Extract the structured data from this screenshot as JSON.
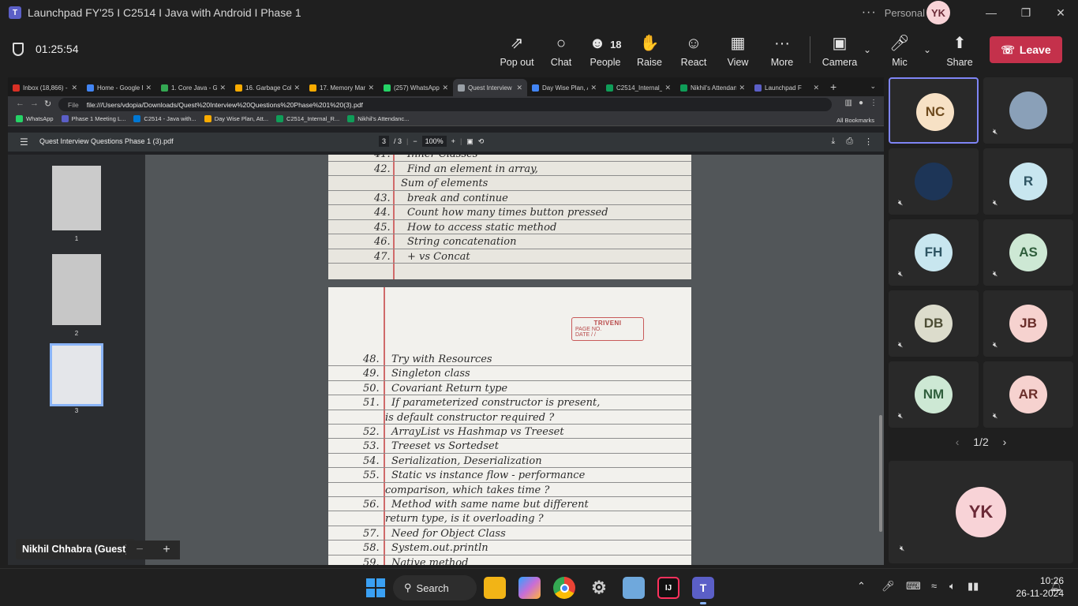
{
  "window": {
    "title": "Launchpad FY'25 I C2514 I Java with Android I Phase 1",
    "more": "···",
    "account": "Personal",
    "avatar_initials": "YK"
  },
  "meeting": {
    "timer": "01:25:54",
    "people_count": "18",
    "tools": [
      {
        "label": "Pop out",
        "icon": "pop-out-icon"
      },
      {
        "label": "Chat",
        "icon": "chat-icon"
      },
      {
        "label": "People",
        "icon": "people-icon"
      },
      {
        "label": "Raise",
        "icon": "raise-hand-icon"
      },
      {
        "label": "React",
        "icon": "react-icon"
      },
      {
        "label": "View",
        "icon": "view-icon"
      },
      {
        "label": "More",
        "icon": "more-icon"
      },
      {
        "label": "Camera",
        "icon": "camera-off-icon"
      },
      {
        "label": "Mic",
        "icon": "mic-off-icon"
      },
      {
        "label": "Share",
        "icon": "share-icon"
      }
    ],
    "leave_label": "Leave",
    "presenter_name": "Nikhil Chhabra (Guest)",
    "zoom_minus": "−",
    "zoom_plus": "+",
    "pager": "1/2"
  },
  "browser": {
    "tabs": [
      {
        "label": "Inbox (18,866) -",
        "color": "#d93025"
      },
      {
        "label": "Home - Google D",
        "color": "#4285f4"
      },
      {
        "label": "1. Core Java - Go",
        "color": "#34a853"
      },
      {
        "label": "16. Garbage Coll",
        "color": "#f9ab00"
      },
      {
        "label": "17. Memory Man",
        "color": "#f9ab00"
      },
      {
        "label": "(257) WhatsApp",
        "color": "#25d366"
      },
      {
        "label": "Quest Interview C",
        "color": "#9aa0a6"
      },
      {
        "label": "Day Wise Plan, A",
        "color": "#4285f4"
      },
      {
        "label": "C2514_Internal_F",
        "color": "#0f9d58"
      },
      {
        "label": "Nikhil's Attendan",
        "color": "#0f9d58"
      },
      {
        "label": "Launchpad F",
        "color": "#5b5fc7"
      }
    ],
    "active_tab": 6,
    "address_scheme": "File",
    "url": "file:///Users/vdopia/Downloads/Quest%20Interview%20Questions%20Phase%201%20(3).pdf",
    "bookmarks": [
      {
        "label": "WhatsApp",
        "color": "#25d366"
      },
      {
        "label": "Phase 1 Meeting L...",
        "color": "#5b5fc7"
      },
      {
        "label": "C2514 - Java with...",
        "color": "#0078d4"
      },
      {
        "label": "Day Wise Plan, Att...",
        "color": "#f9ab00"
      },
      {
        "label": "C2514_Internal_R...",
        "color": "#0f9d58"
      },
      {
        "label": "Nikhil's Attendanc...",
        "color": "#0f9d58"
      }
    ],
    "all_bookmarks": "All Bookmarks"
  },
  "pdf": {
    "file_name": "Quest Interview Questions Phase 1 (3).pdf",
    "page_current": "3",
    "page_total": "/ 3",
    "zoom": "100%",
    "thumbnails": [
      "1",
      "2",
      "3"
    ],
    "page_top_lines": [
      {
        "num": "41.",
        "text": "Inner Classes"
      },
      {
        "num": "42.",
        "text": "Find an element in array,"
      },
      {
        "num": "",
        "text": "Sum of elements"
      },
      {
        "num": "43.",
        "text": "break and continue"
      },
      {
        "num": "44.",
        "text": "Count how many times button pressed"
      },
      {
        "num": "45.",
        "text": "How to access static method"
      },
      {
        "num": "46.",
        "text": "String concatenation"
      },
      {
        "num": "47.",
        "text": "+ vs Concat"
      }
    ],
    "stamp": {
      "brand": "TRIVENI",
      "page_no": "PAGE NO.",
      "date": "DATE  /  /"
    },
    "page_bottom_lines": [
      {
        "num": "48.",
        "text": "Try with Resources"
      },
      {
        "num": "49.",
        "text": "Singleton class"
      },
      {
        "num": "50.",
        "text": "Covariant Return type"
      },
      {
        "num": "51.",
        "text": "If parameterized constructor is present,"
      },
      {
        "num": "",
        "text": "is default constructor required ?"
      },
      {
        "num": "52.",
        "text": "ArrayList vs Hashmap vs Treeset"
      },
      {
        "num": "53.",
        "text": "Treeset vs Sortedset"
      },
      {
        "num": "54.",
        "text": "Serialization, Deserialization"
      },
      {
        "num": "55.",
        "text": "Static vs instance flow - performance"
      },
      {
        "num": "",
        "text": "comparison, which takes time ?"
      },
      {
        "num": "56.",
        "text": "Method with same name but different"
      },
      {
        "num": "",
        "text": "return type, is it overloading ?"
      },
      {
        "num": "57.",
        "text": "Need for Object Class"
      },
      {
        "num": "58.",
        "text": "System.out.println"
      },
      {
        "num": "59.",
        "text": "Native method"
      }
    ]
  },
  "participants": [
    {
      "initials": "NC",
      "bg": "#f7e1c5",
      "fg": "#6e4a1d",
      "muted": false,
      "active": true
    },
    {
      "initials": "",
      "bg": "#8aa0b8",
      "fg": "#1d2a38",
      "muted": true,
      "photo": true
    },
    {
      "initials": "",
      "bg": "#1d3557",
      "fg": "#ffffff",
      "muted": true,
      "logo": true
    },
    {
      "initials": "R",
      "bg": "#c8e6ef",
      "fg": "#2f5563",
      "muted": true
    },
    {
      "initials": "FH",
      "bg": "#c8e6ef",
      "fg": "#2f5563",
      "muted": true
    },
    {
      "initials": "AS",
      "bg": "#cde8d4",
      "fg": "#2f5e3c",
      "muted": true
    },
    {
      "initials": "DB",
      "bg": "#dcdccc",
      "fg": "#4d4d35",
      "muted": true
    },
    {
      "initials": "JB",
      "bg": "#f6d2cf",
      "fg": "#6a2e2a",
      "muted": true
    },
    {
      "initials": "NM",
      "bg": "#cde8d4",
      "fg": "#2f5e3c",
      "muted": true
    },
    {
      "initials": "AR",
      "bg": "#f6d2cf",
      "fg": "#6a2e2a",
      "muted": true
    }
  ],
  "self_view": {
    "initials": "YK",
    "bg": "#f8d3d7",
    "fg": "#6b2a37"
  },
  "taskbar": {
    "search_label": "Search",
    "time": "10:26",
    "date": "26-11-2024",
    "apps": [
      "windows-start",
      "search",
      "file-explorer",
      "copilot",
      "chrome",
      "settings",
      "photos",
      "intellij",
      "teams"
    ]
  }
}
